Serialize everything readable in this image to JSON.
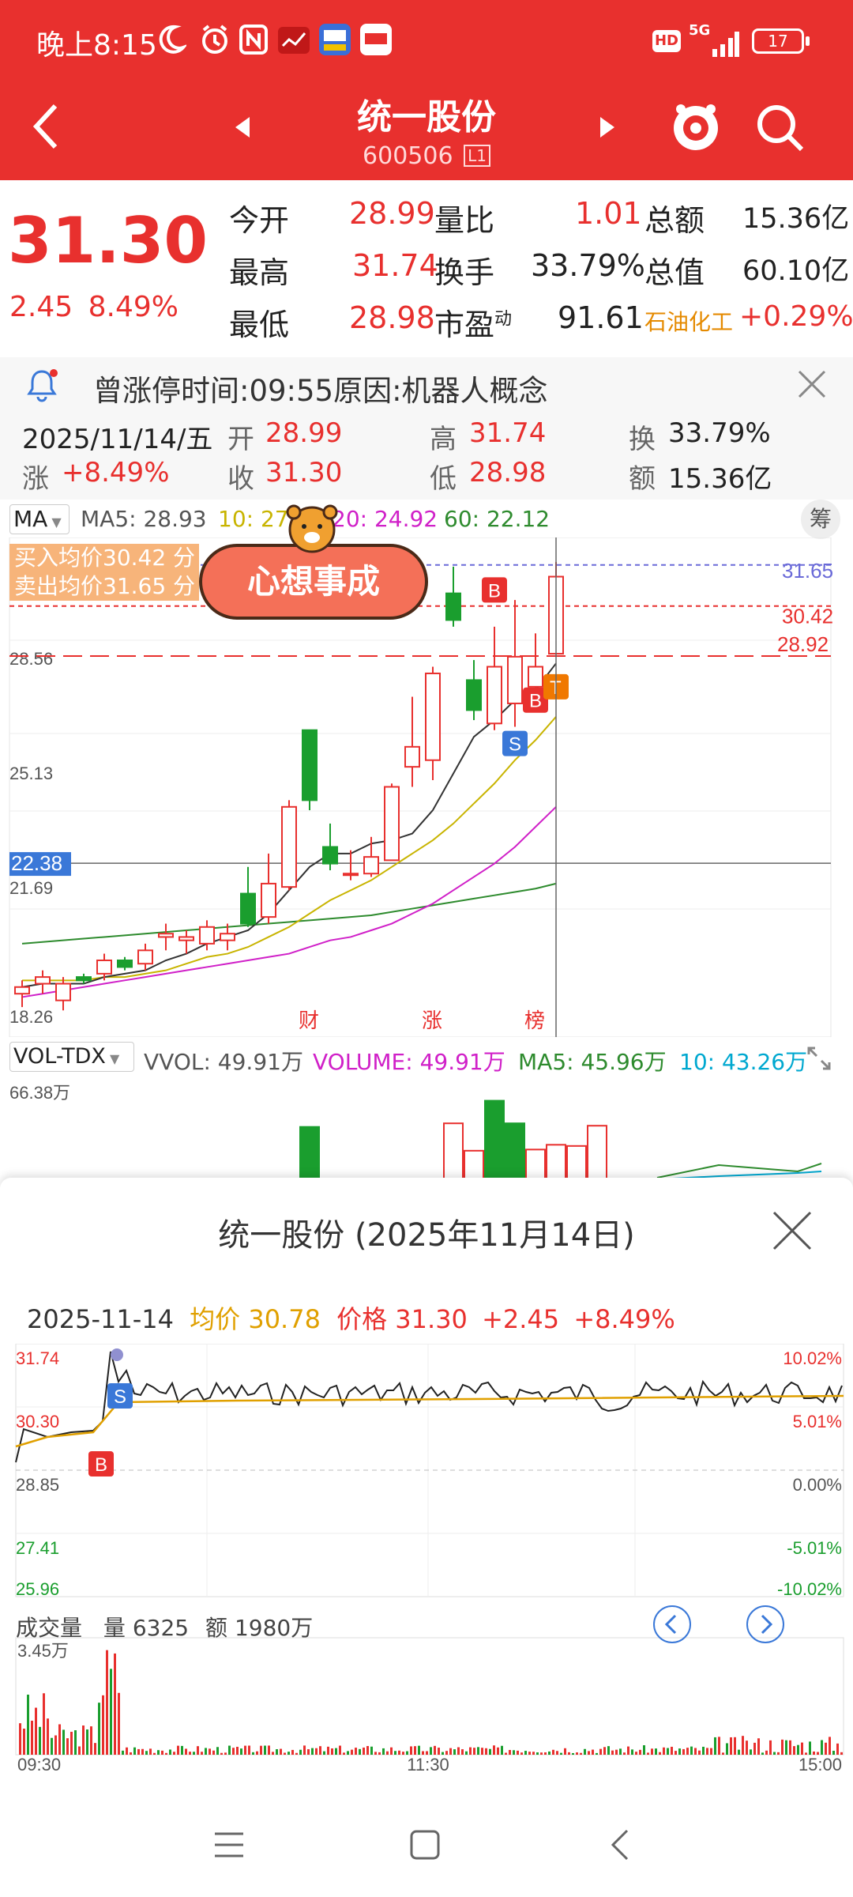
{
  "status_bar": {
    "time": "晚上8:15",
    "battery": "17",
    "network": "5G",
    "hd": "HD"
  },
  "header": {
    "title": "统一股份",
    "code": "600506",
    "level": "L1"
  },
  "quote": {
    "price": "31.30",
    "change": "2.45",
    "change_pct": "8.49%",
    "open_label": "今开",
    "open": "28.99",
    "high_label": "最高",
    "high": "31.74",
    "low_label": "最低",
    "low": "28.98",
    "ratio_label": "量比",
    "ratio": "1.01",
    "turnover_label": "换手",
    "turnover": "33.79%",
    "pe_label": "市盈",
    "pe_sup": "动",
    "pe": "91.61",
    "amount_label": "总额",
    "amount": "15.36亿",
    "mktcap_label": "总值",
    "mktcap": "60.10亿",
    "sector_name": "石油化工",
    "sector_change": "+0.29%"
  },
  "banner": {
    "text": "曾涨停时间:09:55原因:机器人概念"
  },
  "day_info": {
    "date": "2025/11/14/五",
    "open_label": "开",
    "open": "28.99",
    "high_label": "高",
    "high": "31.74",
    "turn_label": "换",
    "turn": "33.79%",
    "chg_label": "涨",
    "chg": "+8.49%",
    "close_label": "收",
    "close": "31.30",
    "low_label": "低",
    "low": "28.98",
    "amt_label": "额",
    "amt": "15.36亿"
  },
  "kline": {
    "ma_selector": "MA",
    "ma5": "MA5: 28.93",
    "ma10": "10: 27.",
    "ma20": "20: 24.92",
    "ma60": "60: 22.12",
    "chip_button": "筹",
    "buy_avg": "买入均价30.42 分",
    "sell_avg": "卖出均价31.65 分",
    "sticker": "心想事成",
    "price_labels": [
      "28.56",
      "25.13",
      "22.38",
      "21.69",
      "18.26"
    ],
    "line_labels": [
      "31.65",
      "30.42",
      "28.92"
    ],
    "event_markers": [
      "财",
      "涨",
      "榜"
    ],
    "trade_markers": [
      "B",
      "S",
      "B",
      "T"
    ],
    "colors": {
      "up": "#e8302e",
      "down": "#1a9e2e",
      "ma5": "#333333",
      "ma10": "#c8b400",
      "ma20": "#d020c8",
      "ma60": "#2e8b2e"
    },
    "candles": [
      {
        "o": 18.8,
        "h": 19.2,
        "l": 18.4,
        "c": 19.0
      },
      {
        "o": 19.1,
        "h": 19.5,
        "l": 18.8,
        "c": 19.3
      },
      {
        "o": 18.6,
        "h": 19.3,
        "l": 18.3,
        "c": 19.1
      },
      {
        "o": 19.3,
        "h": 19.4,
        "l": 19.1,
        "c": 19.2
      },
      {
        "o": 19.4,
        "h": 20.0,
        "l": 19.2,
        "c": 19.8
      },
      {
        "o": 19.8,
        "h": 19.9,
        "l": 19.5,
        "c": 19.6
      },
      {
        "o": 19.7,
        "h": 20.3,
        "l": 19.5,
        "c": 20.1
      },
      {
        "o": 20.5,
        "h": 20.9,
        "l": 20.1,
        "c": 20.6
      },
      {
        "o": 20.4,
        "h": 20.7,
        "l": 20.0,
        "c": 20.5
      },
      {
        "o": 20.3,
        "h": 21.0,
        "l": 20.1,
        "c": 20.8
      },
      {
        "o": 20.4,
        "h": 20.9,
        "l": 20.1,
        "c": 20.6
      },
      {
        "o": 21.8,
        "h": 22.6,
        "l": 20.8,
        "c": 20.9
      },
      {
        "o": 21.1,
        "h": 23.0,
        "l": 20.9,
        "c": 22.1
      },
      {
        "o": 22.0,
        "h": 24.6,
        "l": 21.9,
        "c": 24.4
      },
      {
        "o": 26.7,
        "h": 26.7,
        "l": 24.3,
        "c": 24.6
      },
      {
        "o": 23.2,
        "h": 23.9,
        "l": 22.5,
        "c": 22.7
      },
      {
        "o": 22.4,
        "h": 23.1,
        "l": 22.2,
        "c": 22.4
      },
      {
        "o": 22.4,
        "h": 23.5,
        "l": 22.3,
        "c": 22.9
      },
      {
        "o": 22.8,
        "h": 25.1,
        "l": 22.8,
        "c": 25.0
      },
      {
        "o": 25.6,
        "h": 27.7,
        "l": 25.0,
        "c": 26.2
      },
      {
        "o": 25.8,
        "h": 28.6,
        "l": 25.2,
        "c": 28.4
      },
      {
        "o": 30.8,
        "h": 31.6,
        "l": 29.8,
        "c": 30.0
      },
      {
        "o": 28.2,
        "h": 28.8,
        "l": 27.0,
        "c": 27.3
      },
      {
        "o": 26.9,
        "h": 29.8,
        "l": 26.7,
        "c": 28.6
      },
      {
        "o": 27.5,
        "h": 30.6,
        "l": 26.8,
        "c": 28.9
      },
      {
        "o": 28.0,
        "h": 29.6,
        "l": 27.6,
        "c": 28.6
      },
      {
        "o": 28.99,
        "h": 31.74,
        "l": 28.98,
        "c": 31.3
      }
    ],
    "ma5_values": [
      19.0,
      19.1,
      19.1,
      19.1,
      19.3,
      19.4,
      19.5,
      19.8,
      20.0,
      20.3,
      20.5,
      20.7,
      21.2,
      21.9,
      22.6,
      23.0,
      23.0,
      23.3,
      23.4,
      23.6,
      24.3,
      25.4,
      26.5,
      27.0,
      27.6,
      27.9,
      28.7
    ],
    "ma10_values": [
      19.2,
      19.2,
      19.2,
      19.2,
      19.3,
      19.3,
      19.4,
      19.5,
      19.7,
      19.9,
      20.0,
      20.2,
      20.5,
      20.8,
      21.2,
      21.6,
      21.9,
      22.2,
      22.6,
      23.0,
      23.4,
      23.9,
      24.5,
      25.1,
      25.8,
      26.4,
      27.1
    ],
    "ma20_values": [
      18.7,
      18.8,
      18.9,
      19.0,
      19.1,
      19.2,
      19.3,
      19.4,
      19.5,
      19.6,
      19.7,
      19.8,
      19.9,
      20.0,
      20.2,
      20.4,
      20.5,
      20.7,
      20.9,
      21.2,
      21.5,
      21.9,
      22.3,
      22.7,
      23.2,
      23.8,
      24.4
    ],
    "ma60_values": [
      20.3,
      20.35,
      20.4,
      20.45,
      20.5,
      20.55,
      20.6,
      20.65,
      20.7,
      20.75,
      20.8,
      20.85,
      20.9,
      20.95,
      21.0,
      21.05,
      21.1,
      21.15,
      21.25,
      21.35,
      21.45,
      21.55,
      21.65,
      21.75,
      21.85,
      21.95,
      22.1
    ],
    "ylim": [
      18.26,
      32.0
    ]
  },
  "volume": {
    "indicator": "VOL-TDX",
    "vvol": "VVOL: 49.91万",
    "volume_label": "VOLUME: 49.91万",
    "ma5": "MA5: 45.96万",
    "ma10": "10: 43.26万",
    "max_label": "66.38万",
    "bars": [
      {
        "i": 14,
        "v": 44,
        "up": false
      },
      {
        "i": 21,
        "v": 47,
        "up": true
      },
      {
        "i": 22,
        "v": 24,
        "up": true
      },
      {
        "i": 23,
        "v": 66,
        "up": false
      },
      {
        "i": 24,
        "v": 47,
        "up": false
      },
      {
        "i": 25,
        "v": 25,
        "up": true
      },
      {
        "i": 26,
        "v": 29,
        "up": true
      },
      {
        "i": 27,
        "v": 28,
        "up": true
      },
      {
        "i": 28,
        "v": 45,
        "up": true
      }
    ]
  },
  "intraday": {
    "title": "统一股份 (2025年11月14日)",
    "date": "2025-11-14",
    "avg_label": "均价",
    "avg": "30.78",
    "price_label": "价格",
    "price": "31.30",
    "change": "+2.45",
    "change_pct": "+8.49%",
    "left_axis": [
      "31.74",
      "30.30",
      "28.85",
      "27.41",
      "25.96"
    ],
    "right_axis": [
      "10.02%",
      "5.01%",
      "0.00%",
      "-5.01%",
      "-10.02%"
    ],
    "time_axis": [
      "09:30",
      "11:30",
      "15:00"
    ],
    "markers": [
      "S",
      "B"
    ],
    "vol_title": "成交量",
    "vol_label": "量",
    "vol": "6325",
    "amt_label": "额",
    "amt": "1980万",
    "vol_max": "3.45万"
  }
}
